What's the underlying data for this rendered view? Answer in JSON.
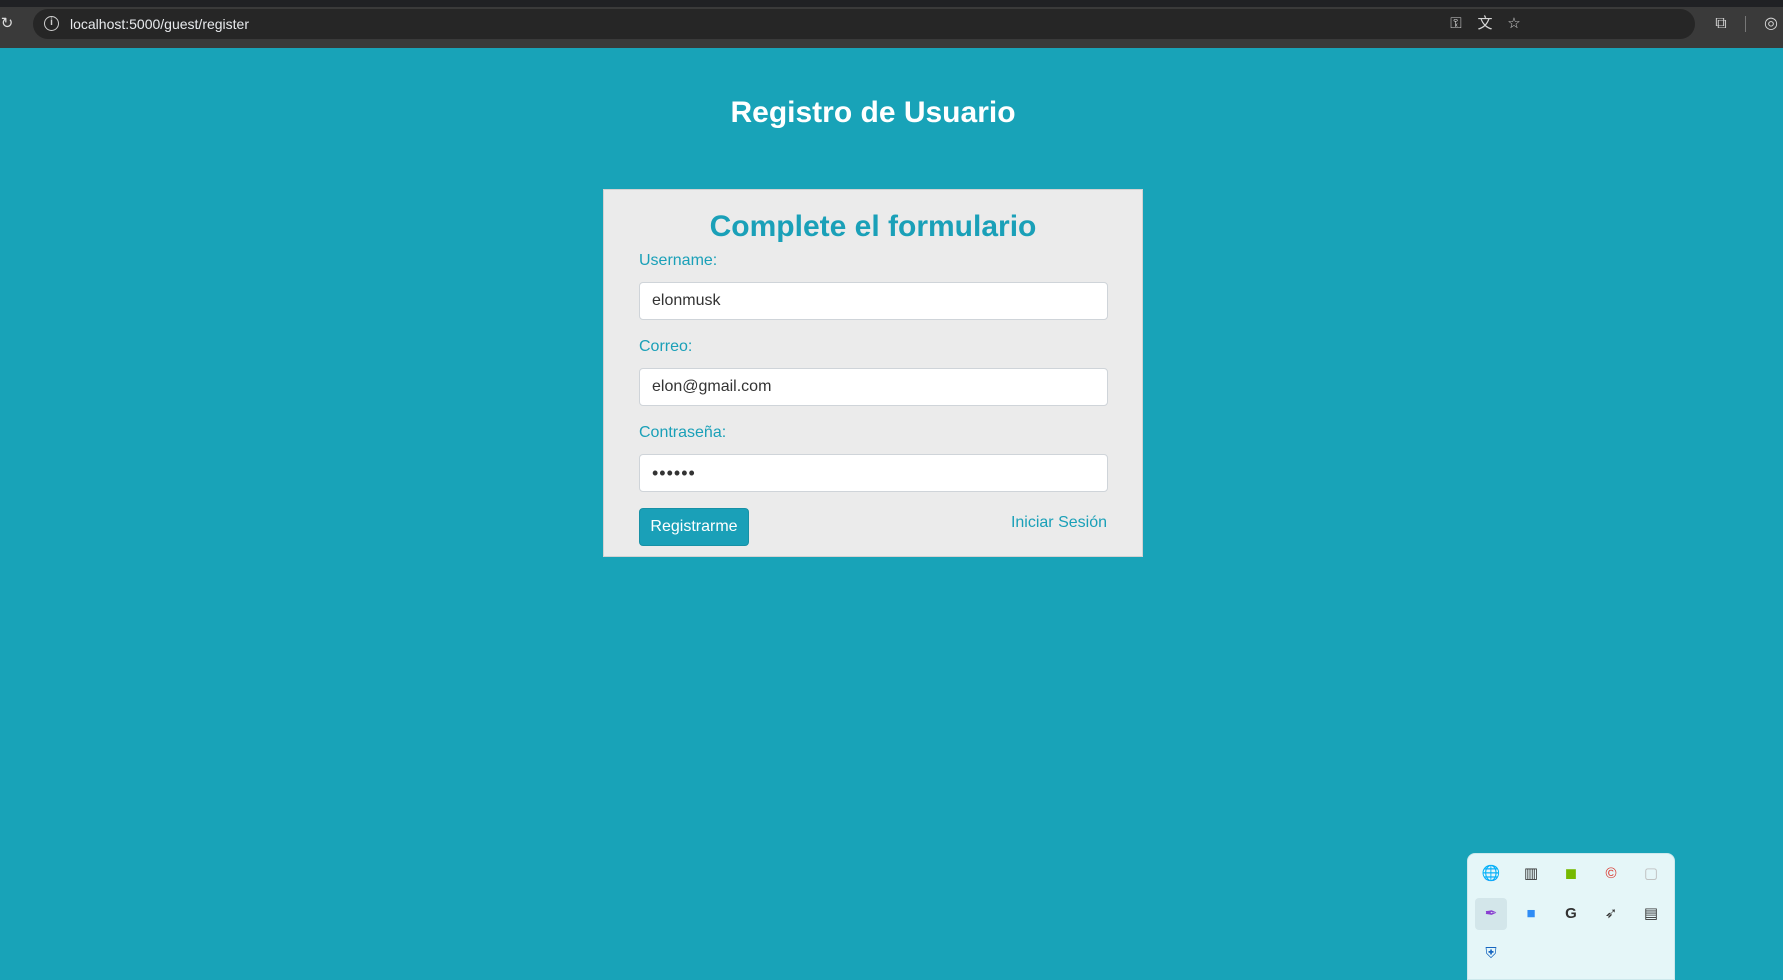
{
  "browser": {
    "url": "localhost:5000/guest/register",
    "icons": {
      "reload": "↻",
      "info": "i",
      "key": "⚿",
      "translate": "文",
      "star": "☆",
      "extensions": "⧉",
      "profile": "◎"
    }
  },
  "page": {
    "title": "Registro de Usuario",
    "background_color": "#18a3b8",
    "accent_color": "#1aa0b8"
  },
  "form": {
    "heading": "Complete el formulario",
    "username_label": "Username:",
    "username_value": "elonmusk",
    "email_label": "Correo:",
    "email_value": "elon@gmail.com",
    "password_label": "Contraseña:",
    "password_value": "••••••",
    "submit_label": "Registrarme",
    "login_link": "Iniciar Sesión"
  },
  "tray": {
    "icons": [
      {
        "name": "network-globe-icon",
        "glyph": "🌐"
      },
      {
        "name": "equalizer-icon",
        "glyph": "▥"
      },
      {
        "name": "nvidia-icon",
        "glyph": "◼"
      },
      {
        "name": "ccleaner-icon",
        "glyph": "©"
      },
      {
        "name": "window-icon",
        "glyph": "▢"
      },
      {
        "name": "feather-icon",
        "glyph": "✒"
      },
      {
        "name": "square-app-icon",
        "glyph": "■"
      },
      {
        "name": "g-logo-icon",
        "glyph": "G"
      },
      {
        "name": "bird-icon",
        "glyph": "➶"
      },
      {
        "name": "network-card-icon",
        "glyph": "▤"
      },
      {
        "name": "security-shield-icon",
        "glyph": "⛨"
      }
    ]
  }
}
